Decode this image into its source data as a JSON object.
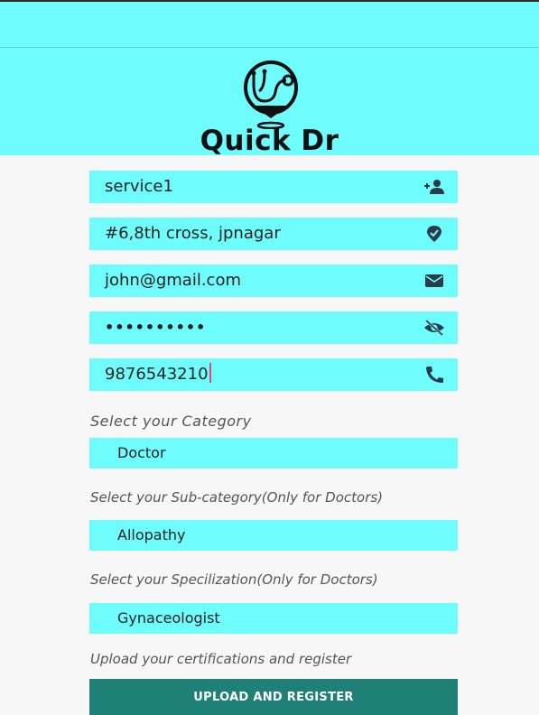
{
  "app": {
    "title": "Quick Dr"
  },
  "colors": {
    "accent": "#6ffcfc",
    "button": "#1f8077",
    "icon": "#2a3b4a",
    "caret": "#e0457b"
  },
  "form": {
    "fields": [
      {
        "name": "name",
        "value": "service1",
        "icon": "add-person-icon"
      },
      {
        "name": "address",
        "value": "#6,8th cross, jpnagar",
        "icon": "location-pin-icon"
      },
      {
        "name": "email",
        "value": "john@gmail.com",
        "icon": "mail-icon"
      },
      {
        "name": "password",
        "value": "••••••••••",
        "icon": "eye-off-icon"
      },
      {
        "name": "phone",
        "value": "9876543210",
        "icon": "phone-icon"
      }
    ],
    "category": {
      "label": "Select your Category",
      "selected": "Doctor"
    },
    "subcategory": {
      "label": "Select your Sub-category(Only for Doctors)",
      "selected": "Allopathy"
    },
    "specialization": {
      "label": "Select your Specilization(Only for Doctors)",
      "selected": "Gynaceologist"
    },
    "upload_hint": "Upload your certifications and register",
    "submit_label": "UPLOAD AND REGISTER"
  }
}
